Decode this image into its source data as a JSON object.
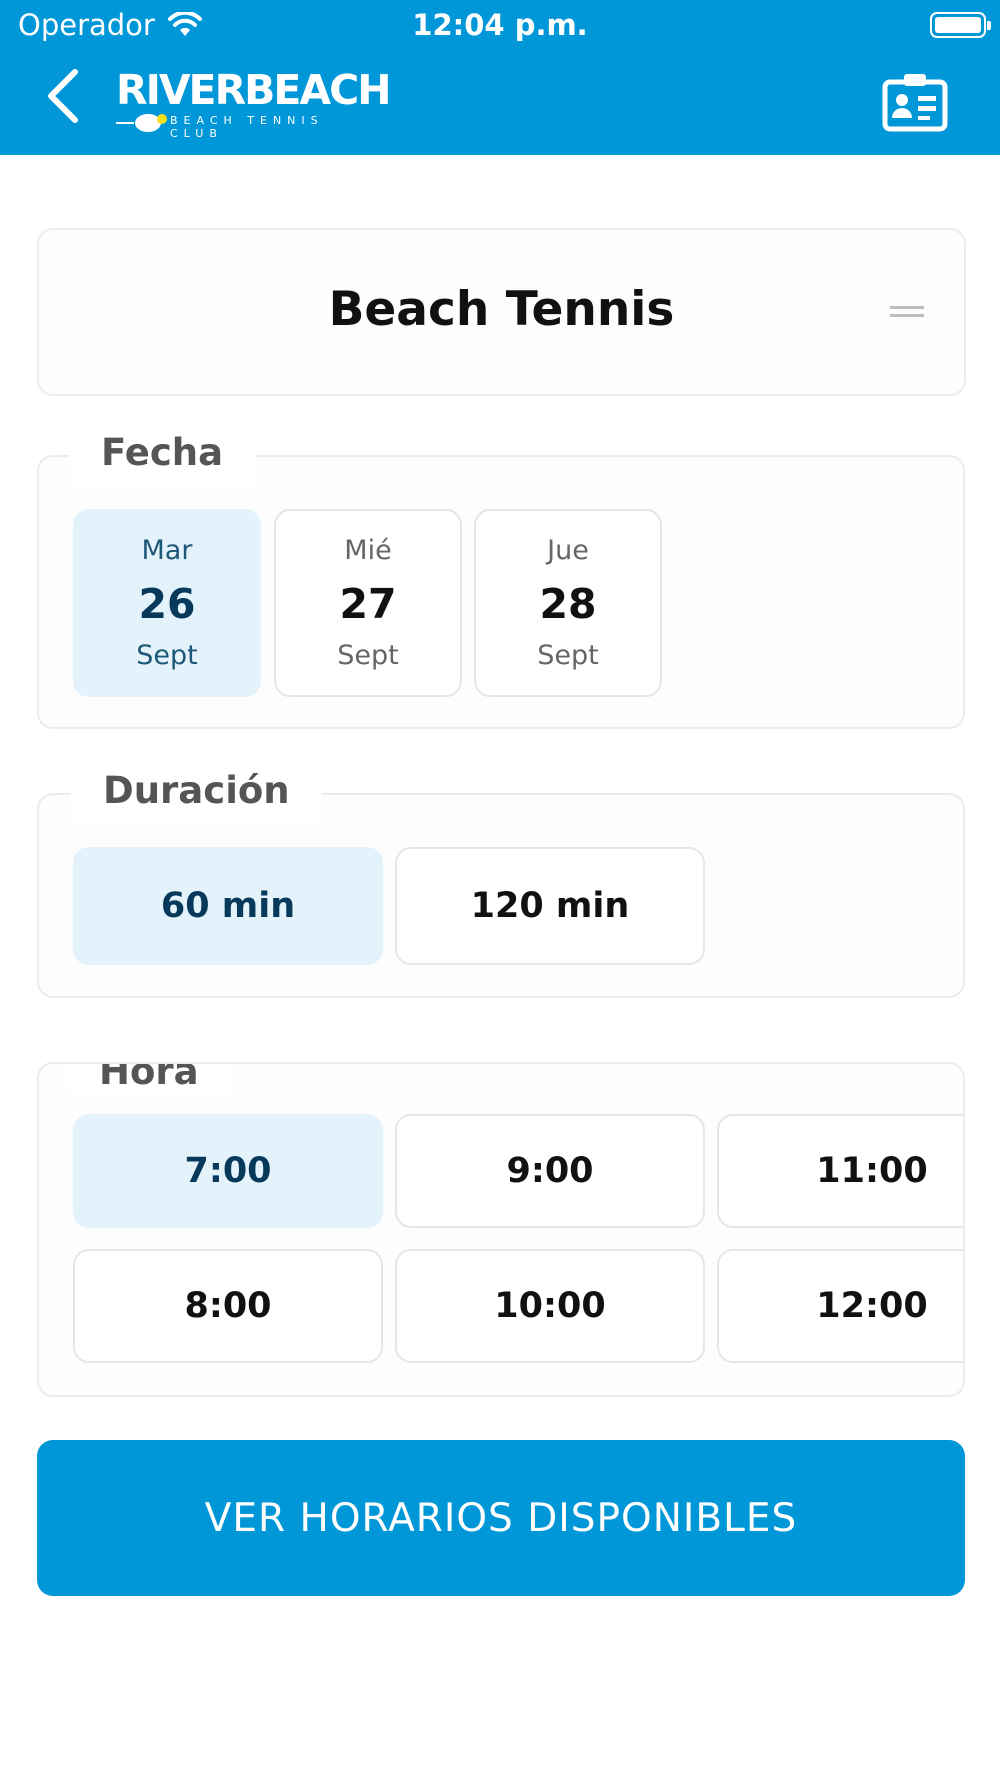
{
  "status_bar": {
    "carrier": "Operador",
    "time": "12:04 p.m."
  },
  "header": {
    "logo_title": "RIVERBEACH",
    "logo_subtitle": "BEACH TENNIS CLUB",
    "back_icon": "chevron-left-icon",
    "card_icon": "contact-card-icon"
  },
  "sport": {
    "title": "Beach Tennis",
    "menu_icon": "menu-lines-icon"
  },
  "fecha": {
    "label": "Fecha",
    "dates": [
      {
        "dow": "Mar",
        "day": "26",
        "month": "Sept",
        "selected": true
      },
      {
        "dow": "Mié",
        "day": "27",
        "month": "Sept",
        "selected": false
      },
      {
        "dow": "Jue",
        "day": "28",
        "month": "Sept",
        "selected": false
      }
    ]
  },
  "duracion": {
    "label": "Duración",
    "options": [
      {
        "label": "60 min",
        "selected": true
      },
      {
        "label": "120 min",
        "selected": false
      }
    ]
  },
  "hora": {
    "label": "Hora",
    "slots": [
      {
        "label": "7:00",
        "selected": true
      },
      {
        "label": "9:00",
        "selected": false
      },
      {
        "label": "11:00",
        "selected": false
      },
      {
        "label": "8:00",
        "selected": false
      },
      {
        "label": "10:00",
        "selected": false
      },
      {
        "label": "12:00",
        "selected": false
      }
    ]
  },
  "cta": {
    "label": "VER HORARIOS DISPONIBLES"
  },
  "colors": {
    "primary": "#0097D9",
    "selected_bg": "#E3F2FB",
    "selected_text": "#07395A",
    "border": "#ececec"
  }
}
